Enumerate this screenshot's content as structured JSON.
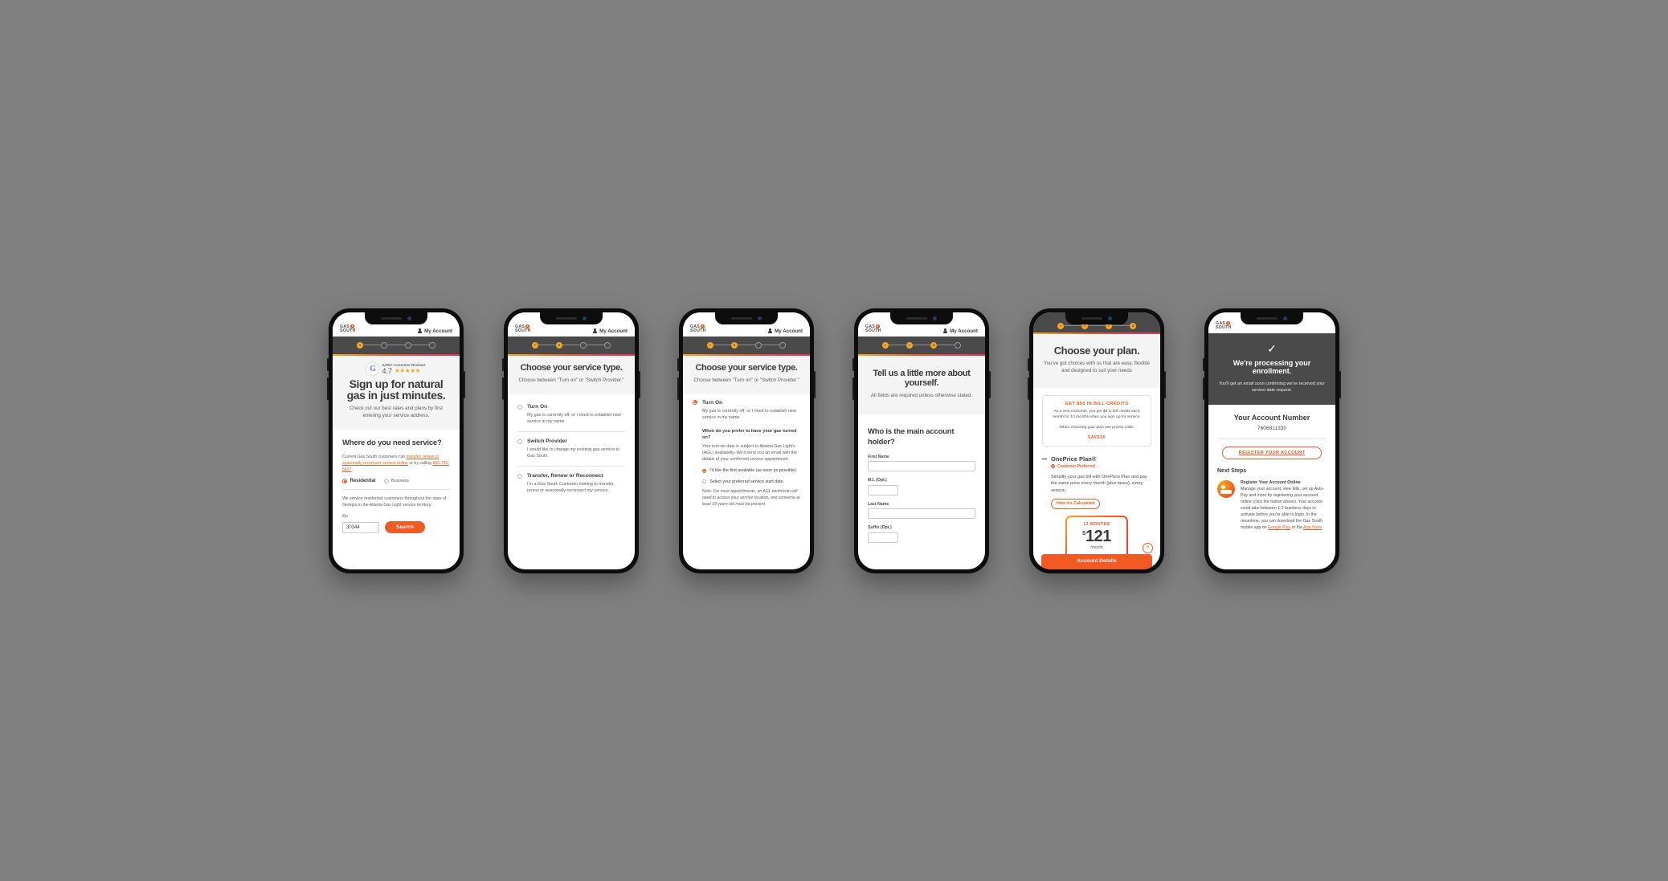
{
  "canvas": {
    "background": "#808080"
  },
  "brand": {
    "logo_line1": "GAS",
    "logo_line2": "SOUTH",
    "accent": "#f15a22",
    "amber": "#f5a623",
    "dark": "#4a4a4a"
  },
  "common": {
    "my_account": "My Account"
  },
  "phones": [
    {
      "id": "phone-1-address",
      "stepper": {
        "steps": [
          "1",
          "",
          "",
          ""
        ],
        "active_index": 0
      },
      "google": {
        "reviews_label": "4,000+ Customer Reviews",
        "rating": "4.7",
        "stars": "★★★★★",
        "icon_letter": "G"
      },
      "title": "Sign up for natural gas in just minutes.",
      "subtitle": "Check out our best rates and plans by first entering your service address.",
      "question": "Where do you need service?",
      "helper_prefix": "Current Gas South customers can ",
      "helper_link": "transfer, renew or seasonally reconnect service online",
      "helper_mid": " or by calling ",
      "helper_phone": "866-762-6427",
      "helper_suffix": ".",
      "options": [
        {
          "label": "Residential",
          "selected": true
        },
        {
          "label": "Business",
          "selected": false
        }
      ],
      "service_note": "We service residential customers throughout the state of Georgia in the Atlanta Gas Light service territory.",
      "zip_label": "Zip",
      "zip_value": "30344",
      "search_label": "Search"
    },
    {
      "id": "phone-2-service-type",
      "stepper": {
        "steps": [
          "✓",
          "2",
          "",
          ""
        ],
        "active_index": 1
      },
      "title": "Choose your service type.",
      "subtitle": "Choose between \"Turn on\" or \"Switch Provider.\"",
      "options": [
        {
          "heading": "Turn On",
          "desc": "My gas is currently off, or I need to establish new service in my name.",
          "selected": false
        },
        {
          "heading": "Switch Provider",
          "desc": "I would like to change my existing gas service to Gas South.",
          "selected": false
        },
        {
          "heading": "Transfer, Renew or Reconnect",
          "desc": "I'm a Gas South Customer looking to transfer, renew or seasonally reconnect my service.",
          "selected": false
        }
      ]
    },
    {
      "id": "phone-3-turn-on-expanded",
      "stepper": {
        "steps": [
          "✓",
          "2",
          "",
          ""
        ],
        "active_index": 1
      },
      "title": "Choose your service type.",
      "subtitle": "Choose between \"Turn on\" or \"Switch Provider.\"",
      "selected_option": {
        "heading": "Turn On",
        "desc": "My gas is currently off, or I need to establish new service in my name.",
        "selected": true
      },
      "sub_question": "When do you prefer to have your gas turned on?",
      "sub_desc": "Your turn-on date is subject to Atlanta Gas Light's (AGL) availability. We'll send you an email with the details of your confirmed service appointment.",
      "sub_options": [
        {
          "label": "I'd like the first available (as soon as possible).",
          "selected": true
        },
        {
          "label": "Select your preferred service start date.",
          "selected": false
        }
      ],
      "note": "Note: For most appointments, an AGL technician will need to access your service location, and someone at least 18 years old must be present."
    },
    {
      "id": "phone-4-about-you",
      "stepper": {
        "steps": [
          "✓",
          "✓",
          "3",
          ""
        ],
        "active_index": 2
      },
      "title": "Tell us a little more about yourself.",
      "subtitle": "All fields are required unless otherwise stated.",
      "question": "Who is the main account holder?",
      "fields": [
        {
          "label": "First Name",
          "value": "",
          "size": "full"
        },
        {
          "label": "M.I. (Opt.)",
          "value": "",
          "size": "short"
        },
        {
          "label": "Last Name",
          "value": "",
          "size": "full"
        },
        {
          "label": "Suffix (Opt.)",
          "value": "",
          "size": "short"
        }
      ]
    },
    {
      "id": "phone-5-choose-plan",
      "stepper": {
        "steps": [
          "✓",
          "✓",
          "✓",
          "4"
        ],
        "active_index": 3
      },
      "title": "Choose your plan.",
      "subtitle": "You've got choices with us that are easy, flexible and designed to suit your needs",
      "promo": {
        "heading": "GET $50 IN BILL CREDITS",
        "body": "As a new customer, you get $5 in bill credits each month for 10 months when you sign up for service.",
        "code_prefix": "When choosing your plan use promo code:",
        "code": "SAVE50"
      },
      "plan": {
        "name": "OnePrice Plan®",
        "badge": "Customer Preferred",
        "desc": "Simplify your gas bill with OnePrice Plan and pay the same price every month (plus taxes), every season.",
        "how_calculated": "How it's Calculated",
        "term": "12 MONTHS",
        "currency": "$",
        "price": "121",
        "per": "/month",
        "help_icon": "?"
      },
      "account_details_bar": "Account Details"
    },
    {
      "id": "phone-6-confirmation",
      "confirm_heading": "We're processing your enrollment.",
      "confirm_body": "You'll get an email soon confirming we've received your service date request.",
      "check_glyph": "✓",
      "account_number_label": "Your Account Number",
      "account_number": "7606811330",
      "register_button": "REGISTER YOUR ACCOUNT",
      "next_steps_label": "Next Steps",
      "next_step": {
        "heading": "Register Your Account Online",
        "body_1": "Manage your account, view bills, set up Auto-Pay and more by registering your account online (click the button above). Your account could take between 1-2 business days to activate before you're able to login. In the meantime, you can download the Gas South mobile app on ",
        "link_1": "Google Play",
        "body_2": " or the ",
        "link_2": "App Store",
        "body_3": "."
      }
    }
  ]
}
